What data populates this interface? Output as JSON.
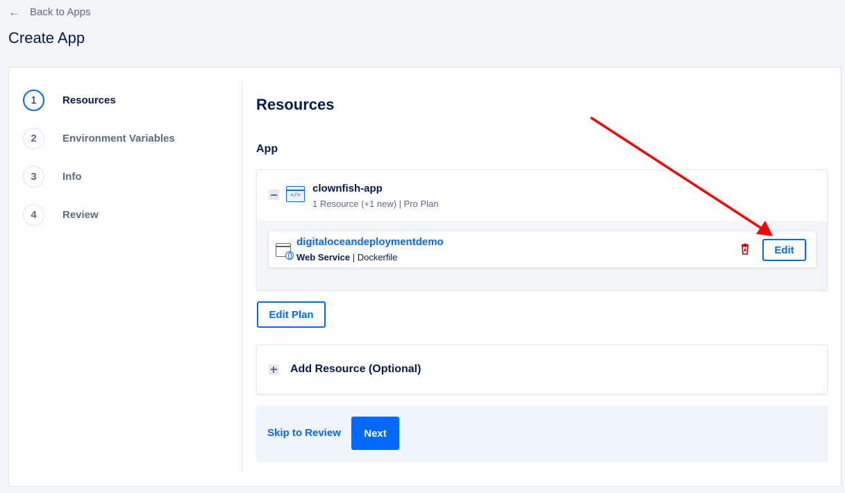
{
  "nav": {
    "back_label": "Back to Apps",
    "back_icon": "arrow-left-icon"
  },
  "page": {
    "title": "Create App"
  },
  "steps": [
    {
      "number": "1",
      "label": "Resources",
      "active": true
    },
    {
      "number": "2",
      "label": "Environment Variables",
      "active": false
    },
    {
      "number": "3",
      "label": "Info",
      "active": false
    },
    {
      "number": "4",
      "label": "Review",
      "active": false
    }
  ],
  "main": {
    "section_title": "Resources",
    "sub_title": "App",
    "app": {
      "name": "clownfish-app",
      "meta": "1 Resource (+1 new) | Pro Plan",
      "icon": "code-window-icon",
      "resource": {
        "name": "digitaloceandeploymentdemo",
        "type": "Web Service",
        "build": "Dockerfile",
        "icon": "web-service-icon",
        "edit_label": "Edit"
      }
    },
    "edit_plan_label": "Edit Plan",
    "add_resource_label": "Add Resource (Optional)",
    "skip_label": "Skip to Review",
    "next_label": "Next"
  },
  "colors": {
    "accent": "#0069ff",
    "text": "#031b4e",
    "muted": "#5b6987",
    "danger": "#c00000",
    "annotation": "#ff0000"
  }
}
